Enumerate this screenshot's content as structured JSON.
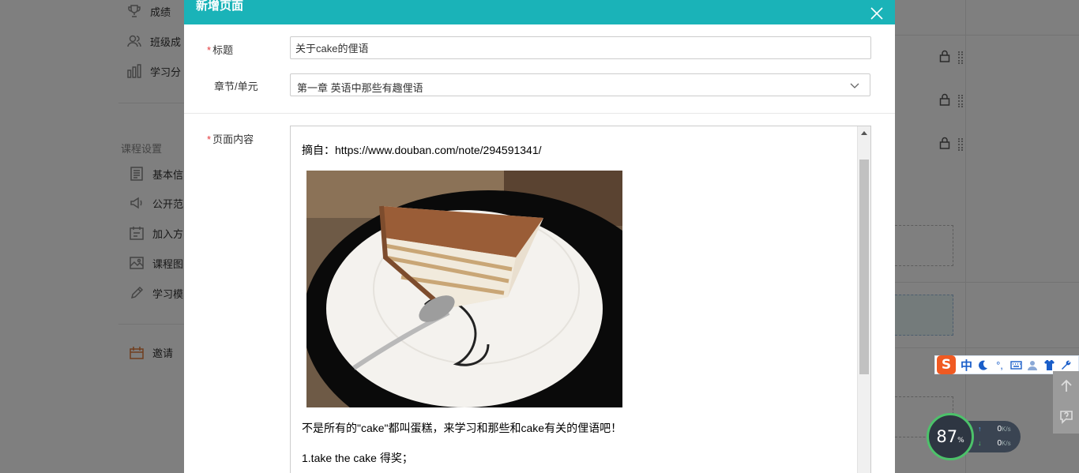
{
  "sidebar": {
    "items": [
      {
        "label": "成绩",
        "icon": "trophy-icon"
      },
      {
        "label": "班级成",
        "icon": "class-icon"
      },
      {
        "label": "学习分",
        "icon": "bar-chart-icon"
      }
    ],
    "section_title": "课程设置",
    "settings_items": [
      {
        "label": "基本信",
        "icon": "document-icon"
      },
      {
        "label": "公开范",
        "icon": "megaphone-icon"
      },
      {
        "label": "加入方",
        "icon": "join-icon"
      },
      {
        "label": "课程图",
        "icon": "image-icon"
      },
      {
        "label": "学习模",
        "icon": "pencil-icon"
      }
    ],
    "invite_label": "邀请"
  },
  "modal": {
    "title": "新增页面",
    "fields": {
      "title_label": "标题",
      "title_value": "关于cake的俚语",
      "chapter_label": "章节/单元",
      "chapter_value": "第一章 英语中那些有趣俚语",
      "content_label": "页面内容"
    },
    "editor": {
      "source": "摘自：https://www.douban.com/note/294591341/",
      "image_alt": "tiramisu-cake-photo",
      "paragraph": "不是所有的\"cake\"都叫蛋糕，来学习和那些和cake有关的俚语吧！",
      "item1": "1.take the cake 得奖；"
    }
  },
  "ime": {
    "logo": "S",
    "mode": "中",
    "glyph_punct": "°,"
  },
  "speed_widget": {
    "percent": "87",
    "percent_unit": "%",
    "upload": "0",
    "download": "0",
    "unit": "K/s"
  },
  "colors": {
    "header": "#1ab3b8",
    "required": "#e4393c",
    "ime_blue": "#1a5ec9",
    "ime_orange": "#f05a22"
  }
}
